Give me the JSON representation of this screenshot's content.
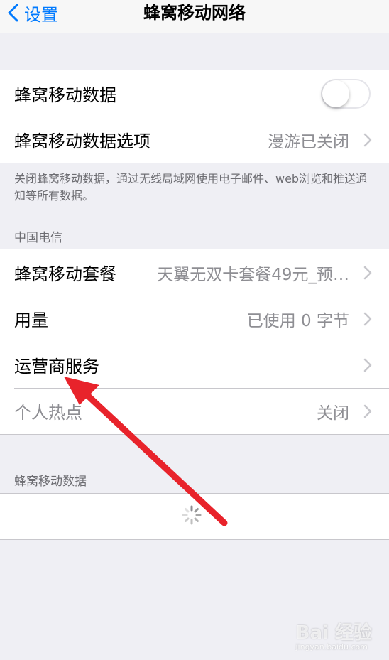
{
  "nav": {
    "back_label": "设置",
    "title": "蜂窝移动网络"
  },
  "group1": {
    "cellular_data": {
      "label": "蜂窝移动数据",
      "toggle_on": false
    },
    "cellular_options": {
      "label": "蜂窝移动数据选项",
      "value": "漫游已关闭"
    }
  },
  "footnote": "关闭蜂窝移动数据，通过无线局域网使用电子邮件、web浏览和推送通知等所有数据。",
  "carrier_header": "中国电信",
  "group2": {
    "plan": {
      "label": "蜂窝移动套餐",
      "value": "天翼无双卡套餐49元_预…"
    },
    "usage": {
      "label": "用量",
      "value": "已使用 0 字节"
    },
    "carrier_services": {
      "label": "运营商服务"
    },
    "hotspot": {
      "label": "个人热点",
      "value": "关闭"
    }
  },
  "section2_header": "蜂窝移动数据",
  "annotation": {
    "arrow_color": "#e8232b"
  },
  "watermark": {
    "brand": "Bai 经验",
    "url": "jingyan.baidu.com"
  },
  "colors": {
    "accent": "#007aff",
    "background": "#efeff4",
    "secondary_text": "#8e8e93"
  }
}
